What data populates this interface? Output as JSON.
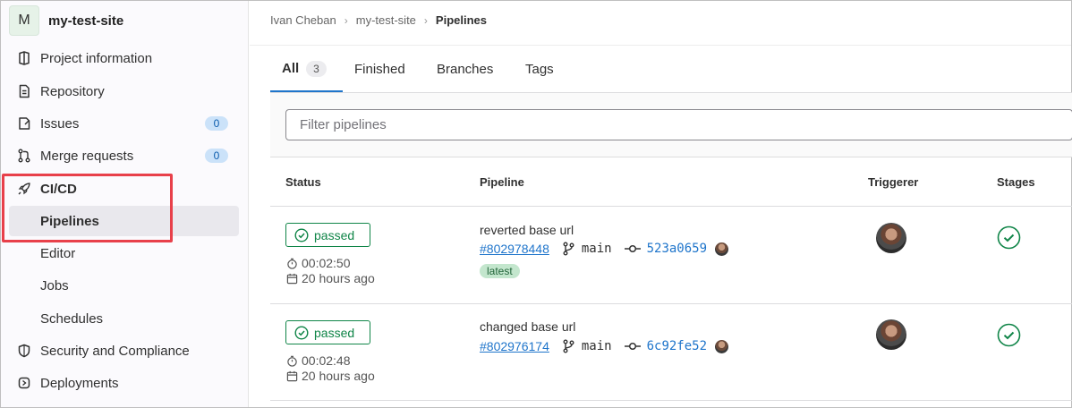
{
  "sidebar": {
    "project_initial": "M",
    "project_name": "my-test-site",
    "items": [
      {
        "label": "Project information",
        "icon": "project-info-icon"
      },
      {
        "label": "Repository",
        "icon": "repository-icon"
      },
      {
        "label": "Issues",
        "icon": "issues-icon",
        "count": "0"
      },
      {
        "label": "Merge requests",
        "icon": "merge-request-icon",
        "count": "0"
      },
      {
        "label": "CI/CD",
        "icon": "rocket-icon"
      },
      {
        "label": "Pipelines"
      },
      {
        "label": "Editor"
      },
      {
        "label": "Jobs"
      },
      {
        "label": "Schedules"
      },
      {
        "label": "Security and Compliance",
        "icon": "shield-icon"
      },
      {
        "label": "Deployments",
        "icon": "deployments-icon"
      }
    ]
  },
  "breadcrumb": {
    "items": [
      "Ivan Cheban",
      "my-test-site",
      "Pipelines"
    ],
    "separator": "›"
  },
  "tabs": [
    {
      "label": "All",
      "count": "3"
    },
    {
      "label": "Finished"
    },
    {
      "label": "Branches"
    },
    {
      "label": "Tags"
    }
  ],
  "filter": {
    "placeholder": "Filter pipelines"
  },
  "table": {
    "headers": {
      "status": "Status",
      "pipeline": "Pipeline",
      "triggerer": "Triggerer",
      "stages": "Stages"
    },
    "rows": [
      {
        "status": "passed",
        "duration": "00:02:50",
        "finished": "20 hours ago",
        "title": "reverted base url",
        "id": "#802978448",
        "branch": "main",
        "sha": "523a0659",
        "tag": "latest"
      },
      {
        "status": "passed",
        "duration": "00:02:48",
        "finished": "20 hours ago",
        "title": "changed base url",
        "id": "#802976174",
        "branch": "main",
        "sha": "6c92fe52"
      }
    ]
  },
  "colors": {
    "success": "#108548",
    "link": "#1f75cb",
    "highlight": "#e8404a",
    "badge_bg": "#cbe2f9"
  }
}
